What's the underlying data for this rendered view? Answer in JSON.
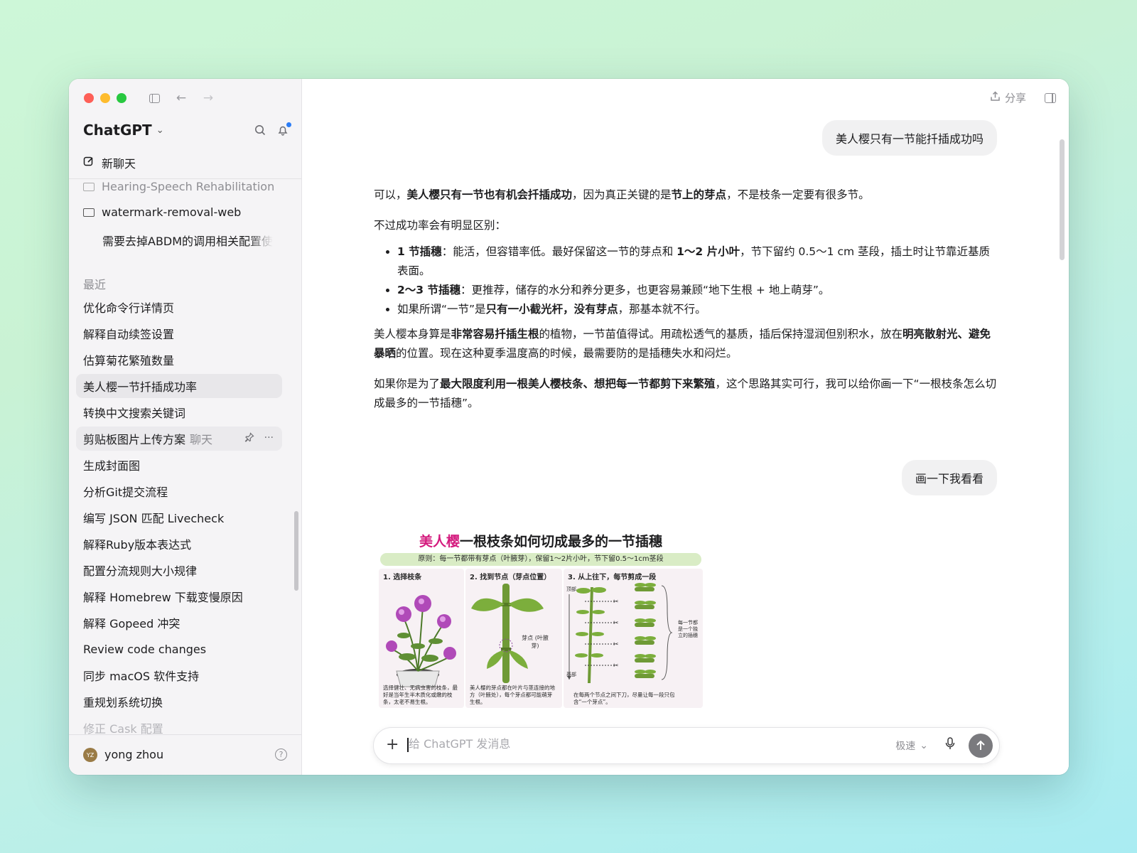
{
  "sidebar": {
    "app_title": "ChatGPT",
    "new_chat": "新聊天",
    "projects": [
      {
        "label": "Hearing-Speech Rehabilitation"
      },
      {
        "label": "watermark-removal-web"
      }
    ],
    "project_sub_item": "需要去掉ABDM的调用相关配置使",
    "recent_title": "最近",
    "items": [
      {
        "label": "优化命令行详情页"
      },
      {
        "label": "解释自动续签设置"
      },
      {
        "label": "估算菊花繁殖数量"
      },
      {
        "label": "美人樱一节扦插成功率"
      },
      {
        "label": "转换中文搜索关键词"
      },
      {
        "label": "剪贴板图片上传方案",
        "suffix": "聊天"
      },
      {
        "label": "生成封面图"
      },
      {
        "label": "分析Git提交流程"
      },
      {
        "label": "编写 JSON 匹配 Livecheck"
      },
      {
        "label": "解释Ruby版本表达式"
      },
      {
        "label": "配置分流规则大小规律"
      },
      {
        "label": "解释 Homebrew 下载变慢原因"
      },
      {
        "label": "解释 Gopeed 冲突"
      },
      {
        "label": "Review code changes"
      },
      {
        "label": "同步 macOS 软件支持"
      },
      {
        "label": "重规划系统切换"
      },
      {
        "label": "修正 Cask 配置"
      }
    ],
    "user": {
      "initials": "YZ",
      "name": "yong zhou"
    }
  },
  "header": {
    "share": "分享"
  },
  "messages": {
    "user1": "美人樱只有一节能扦插成功吗",
    "p1_a": "可以，",
    "p1_b": "美人樱只有一节也有机会扦插成功",
    "p1_c": "，因为真正关键的是",
    "p1_d": "节上的芽点",
    "p1_e": "，不是枝条一定要有很多节。",
    "p2": "不过成功率会有明显区别：",
    "li1_a": "1 节插穗",
    "li1_b": "：能活，但容错率低。最好保留这一节的芽点和 ",
    "li1_c": "1～2 片小叶",
    "li1_d": "，节下留约 0.5～1 cm 茎段，插土时让节靠近基质表面。",
    "li2_a": "2～3 节插穗",
    "li2_b": "：更推荐，储存的水分和养分更多，也更容易兼顾“地下生根 + 地上萌芽”。",
    "li3_a": "如果所谓“一节”是",
    "li3_b": "只有一小截光杆，没有芽点",
    "li3_c": "，那基本就不行。",
    "p3_a": "美人樱本身算是",
    "p3_b": "非常容易扦插生根",
    "p3_c": "的植物，一节苗值得试。用疏松透气的基质，插后保持湿润但别积水，放在",
    "p3_d": "明亮散射光、避免暴晒",
    "p3_e": "的位置。现在这种夏季温度高的时候，最需要防的是插穗失水和闷烂。",
    "p4_a": "如果你是为了",
    "p4_b": "最大限度利用一根美人樱枝条、想把每一节都剪下来繁殖",
    "p4_c": "，这个思路其实可行，我可以给你画一下“一根枝条怎么切成最多的一节插穗”。",
    "user2": "画一下我看看"
  },
  "illustration": {
    "title_pink": "美人樱",
    "title_rest": "一根枝条如何切成最多的一节插穗",
    "banner": "原则：每一节都带有芽点（叶腋芽），保留1～2片小叶，节下留0.5～1cm茎段",
    "panel1_head": "1. 选择枝条",
    "panel1_caption": "选择健壮、无病虫害的枝条，最好是当年生半木质化或嫩的枝条，太老不易生根。",
    "panel2_head": "2. 找到节点（芽点位置）",
    "panel2_label": "芽点 (叶腋芽)",
    "panel2_caption": "美人樱的芽点都在叶片与茎连接的地方（叶腋处），每个芽点都可能萌芽生根。",
    "panel3_head": "3. 从上往下，每节剪成一段",
    "panel3_top": "顶部",
    "panel3_bottom": "基部",
    "panel3_brace": "每一节都是一个独立的插穗",
    "panel3_caption": "在每两个节点之间下刀，尽量让每一段只包含“一个芽点”。"
  },
  "composer": {
    "placeholder": "给 ChatGPT 发消息",
    "speed": "极速"
  },
  "colors": {
    "accent_pink": "#d41b7e",
    "send_button": "#7a7a7e"
  }
}
